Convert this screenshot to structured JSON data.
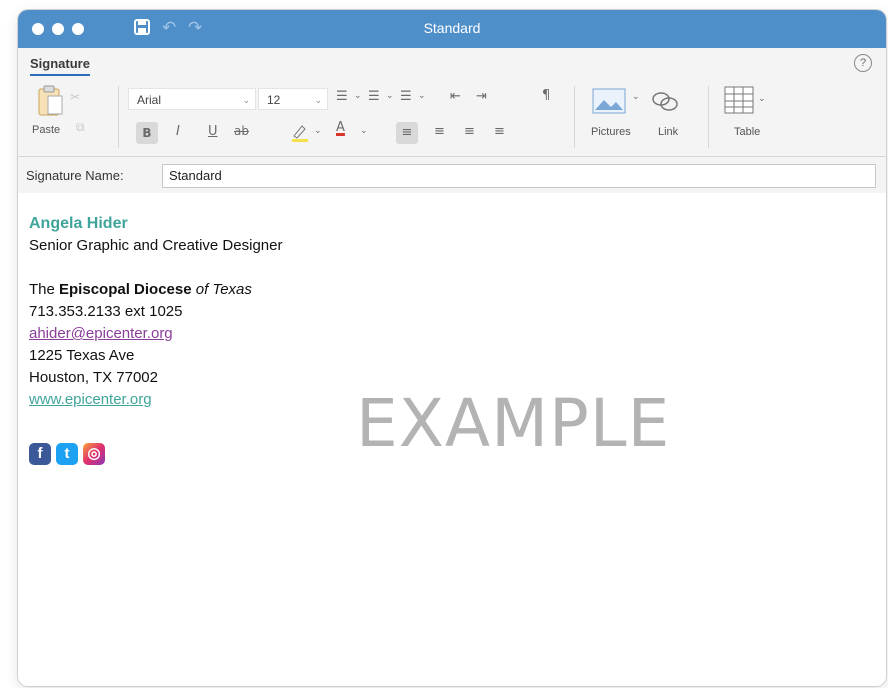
{
  "window": {
    "title": "Standard"
  },
  "tabs": [
    {
      "label": "Signature",
      "active": true
    }
  ],
  "help": {
    "glyph": "?"
  },
  "ribbon": {
    "paste_label": "Paste",
    "font_name": "Arial",
    "font_size": "12",
    "bold_glyph": "B",
    "italic_glyph": "I",
    "underline_glyph": "U",
    "strike_glyph": "ab",
    "font_color_glyph": "A",
    "pilcrow_glyph": "¶",
    "pictures_label": "Pictures",
    "link_label": "Link",
    "table_label": "Table"
  },
  "signature_name": {
    "label": "Signature Name:",
    "value": "Standard"
  },
  "signature": {
    "name": "Angela Hider",
    "job_title": "Senior Graphic and Creative Designer",
    "org_prefix": "The ",
    "org_bold": "Episcopal Diocese",
    "org_italic": " of Texas",
    "phone": "713.353.2133 ext 1025",
    "email": "ahider@epicenter.org",
    "address_line1": "1225 Texas Ave",
    "address_line2": "Houston, TX 77002",
    "website": "www.epicenter.org"
  },
  "social_icons": [
    {
      "name": "facebook-icon",
      "glyph": "f",
      "color": "#3b5998"
    },
    {
      "name": "twitter-icon",
      "glyph": "t",
      "color": "#1da1f2"
    },
    {
      "name": "instagram-icon",
      "glyph": "◎",
      "color": "#e1306c"
    }
  ],
  "watermark": "EXAMPLE",
  "colors": {
    "titlebar": "#4f8fc9",
    "accent_tab": "#2a6db5",
    "name_color": "#3fa59a",
    "email_color": "#8b3d9a"
  }
}
